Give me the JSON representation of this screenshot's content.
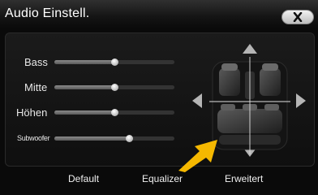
{
  "window": {
    "title": "Audio Einstell."
  },
  "sliders": [
    {
      "label": "Bass",
      "value_percent": 50
    },
    {
      "label": "Mitte",
      "value_percent": 50
    },
    {
      "label": "Höhen",
      "value_percent": 50
    },
    {
      "label": "Subwoofer",
      "value_percent": 62
    }
  ],
  "footer": {
    "default_label": "Default",
    "equalizer_label": "Equalizer",
    "advanced_label": "Erweitert"
  },
  "icons": {
    "close": "close-x-icon",
    "up": "arrow-up-icon",
    "down": "arrow-down-icon",
    "left": "arrow-left-icon",
    "right": "arrow-right-icon",
    "car": "car-seats-icon",
    "pointer": "pointer-arrow-icon"
  },
  "colors": {
    "accent_pointer": "#f5b800"
  }
}
